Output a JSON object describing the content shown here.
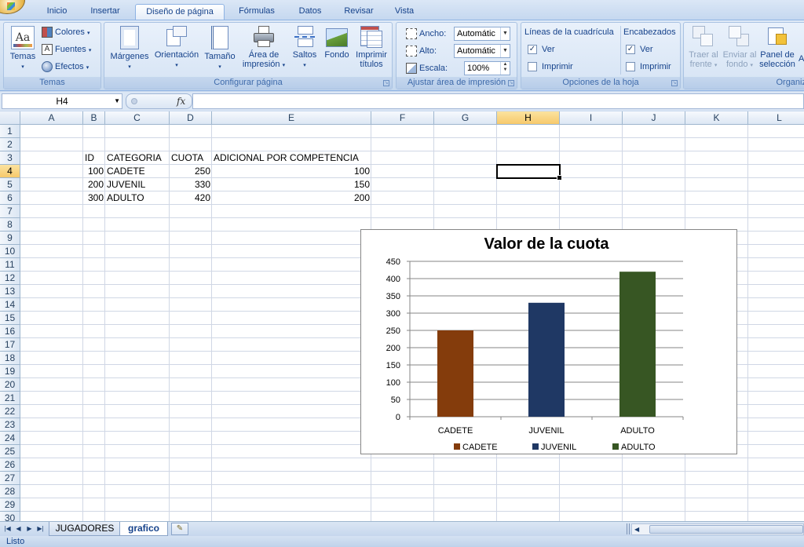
{
  "ribbon_tabs": [
    {
      "label": "Inicio",
      "active": false
    },
    {
      "label": "Insertar",
      "active": false
    },
    {
      "label": "Diseño de página",
      "active": true
    },
    {
      "label": "Fórmulas",
      "active": false
    },
    {
      "label": "Datos",
      "active": false
    },
    {
      "label": "Revisar",
      "active": false
    },
    {
      "label": "Vista",
      "active": false
    }
  ],
  "groups": {
    "temas": {
      "title": "Temas",
      "btn": "Temas",
      "colores": "Colores",
      "fuentes": "Fuentes",
      "efectos": "Efectos",
      "big_glyph": "Aa"
    },
    "configurar": {
      "title": "Configurar página",
      "margenes": "Márgenes",
      "orientacion": "Orientación",
      "tamano": "Tamaño",
      "area1": "Área de",
      "area2": "impresión",
      "saltos": "Saltos",
      "fondo": "Fondo",
      "imprimir1": "Imprimir",
      "imprimir2": "títulos"
    },
    "ajustar": {
      "title": "Ajustar área de impresión",
      "ancho_label": "Ancho:",
      "ancho_value": "Automátic",
      "alto_label": "Alto:",
      "alto_value": "Automátic",
      "escala_label": "Escala:",
      "escala_value": "100%"
    },
    "opciones": {
      "title": "Opciones de la hoja",
      "lineas": "Líneas de la cuadrícula",
      "encabezados": "Encabezados",
      "ver": "Ver",
      "imprimir": "Imprimir",
      "lineas_ver_checked": true,
      "lineas_imprimir_checked": false,
      "enc_ver_checked": true,
      "enc_imprimir_checked": false
    },
    "organizar": {
      "title": "Organiz",
      "traer1": "Traer al",
      "traer2": "frente",
      "enviar1": "Enviar al",
      "enviar2": "fondo",
      "panel1": "Panel de",
      "panel2": "selección",
      "extra": "A"
    }
  },
  "formula_bar": {
    "name_box": "H4",
    "fx": "fx",
    "formula": ""
  },
  "grid": {
    "columns": [
      "A",
      "B",
      "C",
      "D",
      "E",
      "F",
      "G",
      "H",
      "I",
      "J",
      "K",
      "L"
    ],
    "selected_column": "H",
    "row_count": 30,
    "selected_row": 4,
    "cells": [
      {
        "row": 3,
        "col": "B",
        "text": "ID",
        "align": "left"
      },
      {
        "row": 3,
        "col": "C",
        "text": "CATEGORIA",
        "align": "left"
      },
      {
        "row": 3,
        "col": "D",
        "text": "CUOTA",
        "align": "left"
      },
      {
        "row": 3,
        "col": "E",
        "text": "ADICIONAL POR COMPETENCIA",
        "align": "left"
      },
      {
        "row": 4,
        "col": "B",
        "text": "100",
        "align": "right"
      },
      {
        "row": 4,
        "col": "C",
        "text": "CADETE",
        "align": "left"
      },
      {
        "row": 4,
        "col": "D",
        "text": "250",
        "align": "right"
      },
      {
        "row": 4,
        "col": "E",
        "text": "100",
        "align": "right"
      },
      {
        "row": 5,
        "col": "B",
        "text": "200",
        "align": "right"
      },
      {
        "row": 5,
        "col": "C",
        "text": "JUVENIL",
        "align": "left"
      },
      {
        "row": 5,
        "col": "D",
        "text": "330",
        "align": "right"
      },
      {
        "row": 5,
        "col": "E",
        "text": "150",
        "align": "right"
      },
      {
        "row": 6,
        "col": "B",
        "text": "300",
        "align": "right"
      },
      {
        "row": 6,
        "col": "C",
        "text": "ADULTO",
        "align": "left"
      },
      {
        "row": 6,
        "col": "D",
        "text": "420",
        "align": "right"
      },
      {
        "row": 6,
        "col": "E",
        "text": "200",
        "align": "right"
      }
    ]
  },
  "chart_data": {
    "type": "bar",
    "title": "Valor de la cuota",
    "categories": [
      "CADETE",
      "JUVENIL",
      "ADULTO"
    ],
    "values": [
      250,
      330,
      420
    ],
    "colors": [
      "#843c0c",
      "#1f3864",
      "#375623"
    ],
    "ylim": [
      0,
      450
    ],
    "yticks": [
      0,
      50,
      100,
      150,
      200,
      250,
      300,
      350,
      400,
      450
    ],
    "grid": true,
    "legend": "bottom",
    "xlabel": "",
    "ylabel": ""
  },
  "sheets": [
    {
      "name": "JUGADORES",
      "active": false
    },
    {
      "name": "grafico",
      "active": true
    }
  ],
  "status": "Listo"
}
